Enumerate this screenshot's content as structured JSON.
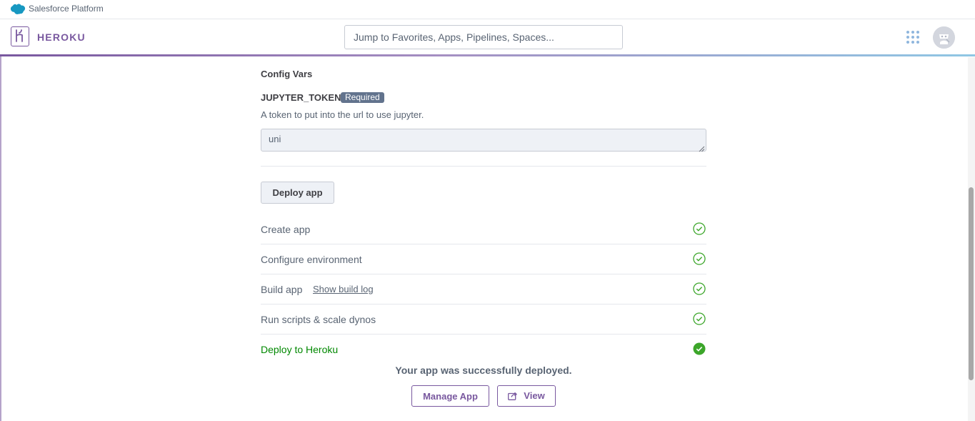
{
  "salesforce_bar": {
    "label": "Salesforce Platform",
    "icon": "salesforce-cloud-icon",
    "cloud_color": "#1798c1"
  },
  "header": {
    "logo_icon": "heroku-logo-icon",
    "logo_text": "HEROKU",
    "search_placeholder": "Jump to Favorites, Apps, Pipelines, Spaces...",
    "apps_icon": "apps-grid-icon",
    "avatar_icon": "avatar-icon",
    "brand_color": "#79589f"
  },
  "config": {
    "section_title": "Config Vars",
    "var_name": "JUPYTER_TOKEN",
    "badge": "Required",
    "description": "A token to put into the url to use jupyter.",
    "value": "uni"
  },
  "deploy": {
    "button_label": "Deploy app",
    "steps": [
      {
        "label": "Create app",
        "status": "done"
      },
      {
        "label": "Configure environment",
        "status": "done"
      },
      {
        "label": "Build app",
        "link": "Show build log",
        "status": "done"
      },
      {
        "label": "Run scripts & scale dynos",
        "status": "done"
      },
      {
        "label": "Deploy to Heroku",
        "status": "complete"
      }
    ],
    "check_color": "#3ca62a",
    "success_message": "Your app was successfully deployed.",
    "manage_label": "Manage App",
    "view_label": "View",
    "view_icon": "external-link-icon"
  }
}
